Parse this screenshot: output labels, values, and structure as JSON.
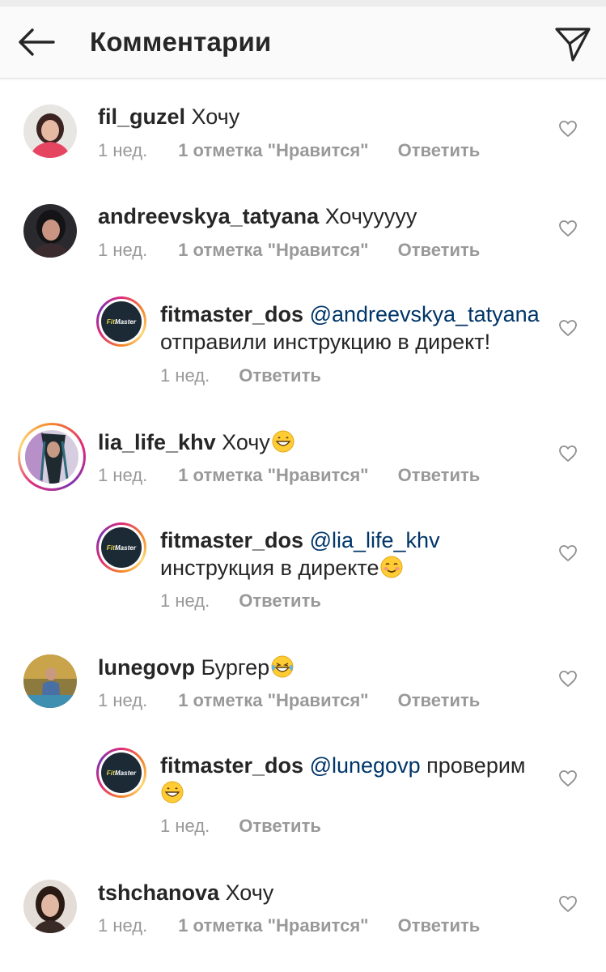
{
  "header": {
    "title": "Комментарии",
    "back_icon": "arrow-left-icon",
    "send_icon": "paper-plane-icon"
  },
  "comments": [
    {
      "username": "fil_guzel",
      "text": "Хочу",
      "time": "1 нед.",
      "likes": "1 отметка \"Нравится\"",
      "reply": "Ответить"
    },
    {
      "username": "andreevskya_tatyana",
      "text": "Хочууууу",
      "time": "1 нед.",
      "likes": "1 отметка \"Нравится\"",
      "reply": "Ответить",
      "replies": [
        {
          "username": "fitmaster_dos",
          "mention": "@andreevskya_tatyana",
          "text": "отправили инструкцию в директ!",
          "time": "1 нед.",
          "reply": "Ответить"
        }
      ]
    },
    {
      "username": "lia_life_khv",
      "text": "Хочу",
      "emoji": "grinning-face-emoji",
      "time": "1 нед.",
      "likes": "1 отметка \"Нравится\"",
      "reply": "Ответить",
      "replies": [
        {
          "username": "fitmaster_dos",
          "mention": "@lia_life_khv",
          "text": "инструкция в директе",
          "emoji": "smiling-face-emoji",
          "time": "1 нед.",
          "reply": "Ответить"
        }
      ]
    },
    {
      "username": "lunegovp",
      "text": "Бургер",
      "emoji": "tears-of-joy-emoji",
      "time": "1 нед.",
      "likes": "1 отметка \"Нравится\"",
      "reply": "Ответить",
      "replies": [
        {
          "username": "fitmaster_dos",
          "mention": "@lunegovp",
          "text": "проверим",
          "emoji": "grinning-face-emoji",
          "time": "1 нед.",
          "reply": "Ответить"
        }
      ]
    },
    {
      "username": "tshchanova",
      "text": "Хочу",
      "time": "1 нед.",
      "likes": "1 отметка \"Нравится\"",
      "reply": "Ответить"
    }
  ],
  "reply_avatar_logo": {
    "brand": "Fit",
    "accent": "Master"
  },
  "colors": {
    "text": "#262626",
    "meta": "#999999",
    "mention": "#003569",
    "header_bg": "#fafafa"
  }
}
